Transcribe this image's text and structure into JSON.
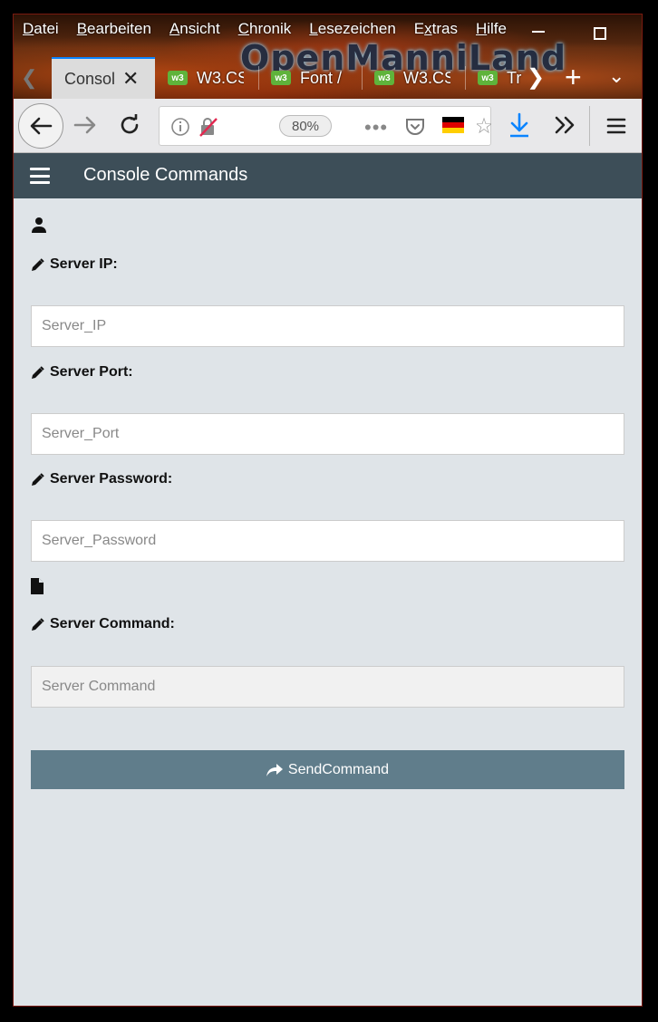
{
  "browser": {
    "menu": [
      {
        "prefix": "",
        "underline": "D",
        "rest": "atei"
      },
      {
        "prefix": "",
        "underline": "B",
        "rest": "earbeiten"
      },
      {
        "prefix": "",
        "underline": "A",
        "rest": "nsicht"
      },
      {
        "prefix": "",
        "underline": "C",
        "rest": "hronik"
      },
      {
        "prefix": "",
        "underline": "L",
        "rest": "esezeichen"
      },
      {
        "prefix": "E",
        "underline": "x",
        "rest": "tras"
      },
      {
        "prefix": "",
        "underline": "H",
        "rest": "ilfe"
      }
    ],
    "theme_brand": "OpenManniLand",
    "tabs": {
      "active": {
        "title": "Consol"
      },
      "others": [
        {
          "title": "W3.CS",
          "favicon": "w3"
        },
        {
          "title": "Font /",
          "favicon": "w3"
        },
        {
          "title": "W3.CS",
          "favicon": "w3"
        },
        {
          "title": "Tr",
          "favicon": "w3"
        }
      ]
    },
    "zoom": "80%",
    "accent_download": "#0a84ff"
  },
  "app": {
    "title": "Console Commands",
    "header_color": "#3d4e58",
    "fields": {
      "ip": {
        "label": "Server IP:",
        "placeholder": "Server_IP"
      },
      "port": {
        "label": "Server Port:",
        "placeholder": "Server_Port"
      },
      "password": {
        "label": "Server Password:",
        "placeholder": "Server_Password"
      },
      "command": {
        "label": "Server Command:",
        "placeholder": "Server Command"
      }
    },
    "send_button": "SendCommand",
    "button_color": "#607d8b"
  }
}
